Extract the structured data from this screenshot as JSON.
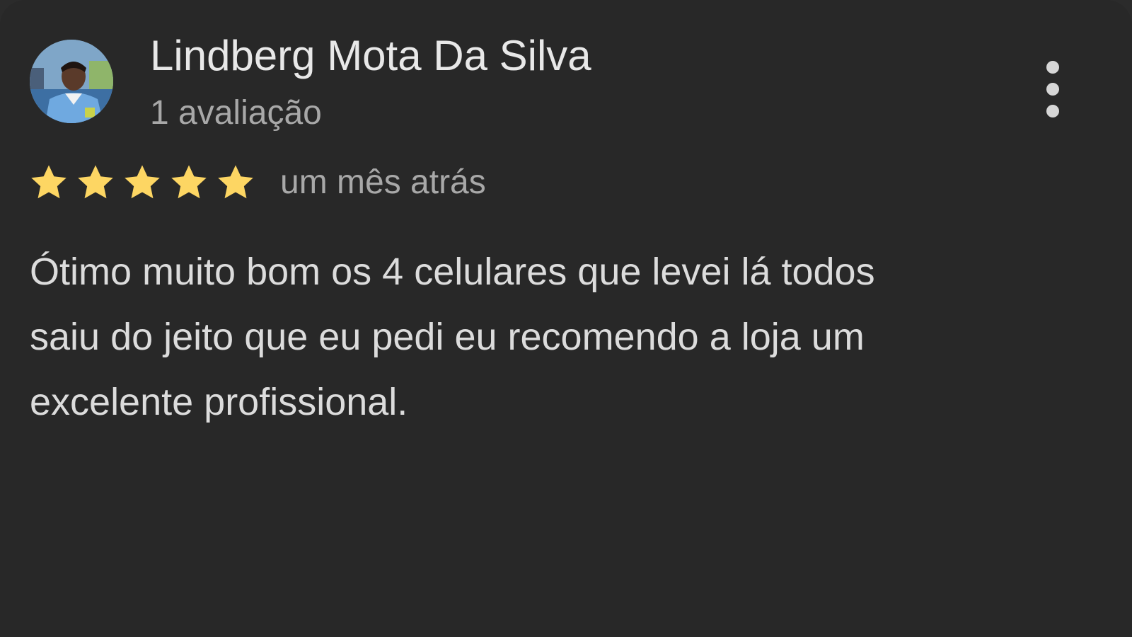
{
  "review": {
    "author_name": "Lindberg Mota Da Silva",
    "review_count": "1 avaliação",
    "rating": 5,
    "rating_max": 5,
    "time_ago": "um mês atrás",
    "text_lines": [
      "Ótimo muito bom os 4 celulares que levei lá todos",
      "saiu do jeito que eu pedi eu recomendo a loja um",
      "excelente profissional."
    ]
  },
  "icons": {
    "avatar": "user-avatar-photo",
    "menu": "more-vertical-icon",
    "star": "star-icon"
  },
  "colors": {
    "background": "#282828",
    "star_filled": "#fdd663",
    "primary_text": "#e8e8e8",
    "secondary_text": "#a8a8a8"
  }
}
